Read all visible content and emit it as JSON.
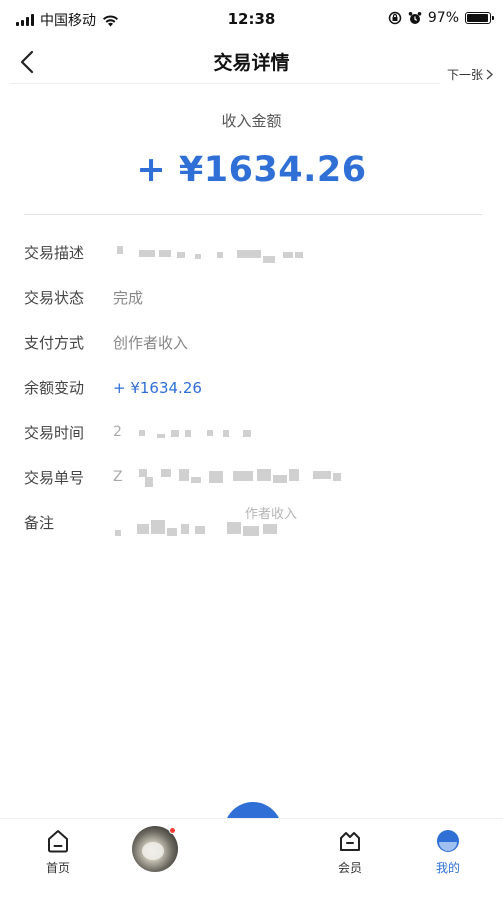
{
  "status_bar": {
    "carrier": "中国移动",
    "time": "12:38",
    "battery": "97%"
  },
  "nav": {
    "title": "交易详情",
    "next_label": "下一张"
  },
  "amount": {
    "label": "收入金额",
    "value": "+ ¥1634.26"
  },
  "details": {
    "description": {
      "label": "交易描述"
    },
    "status": {
      "label": "交易状态",
      "value": "完成"
    },
    "payment_method": {
      "label": "支付方式",
      "value": "创作者收入"
    },
    "balance_change": {
      "label": "余额变动",
      "value": "+ ¥1634.26"
    },
    "time": {
      "label": "交易时间",
      "value_visible": "2"
    },
    "order_no": {
      "label": "交易单号",
      "value_visible": "Z"
    },
    "remark": {
      "label": "备注",
      "value_visible": "作者收入"
    }
  },
  "tab_bar": {
    "home": "首页",
    "member": "会员",
    "mine": "我的"
  },
  "colors": {
    "accent": "#2f6fd6"
  }
}
